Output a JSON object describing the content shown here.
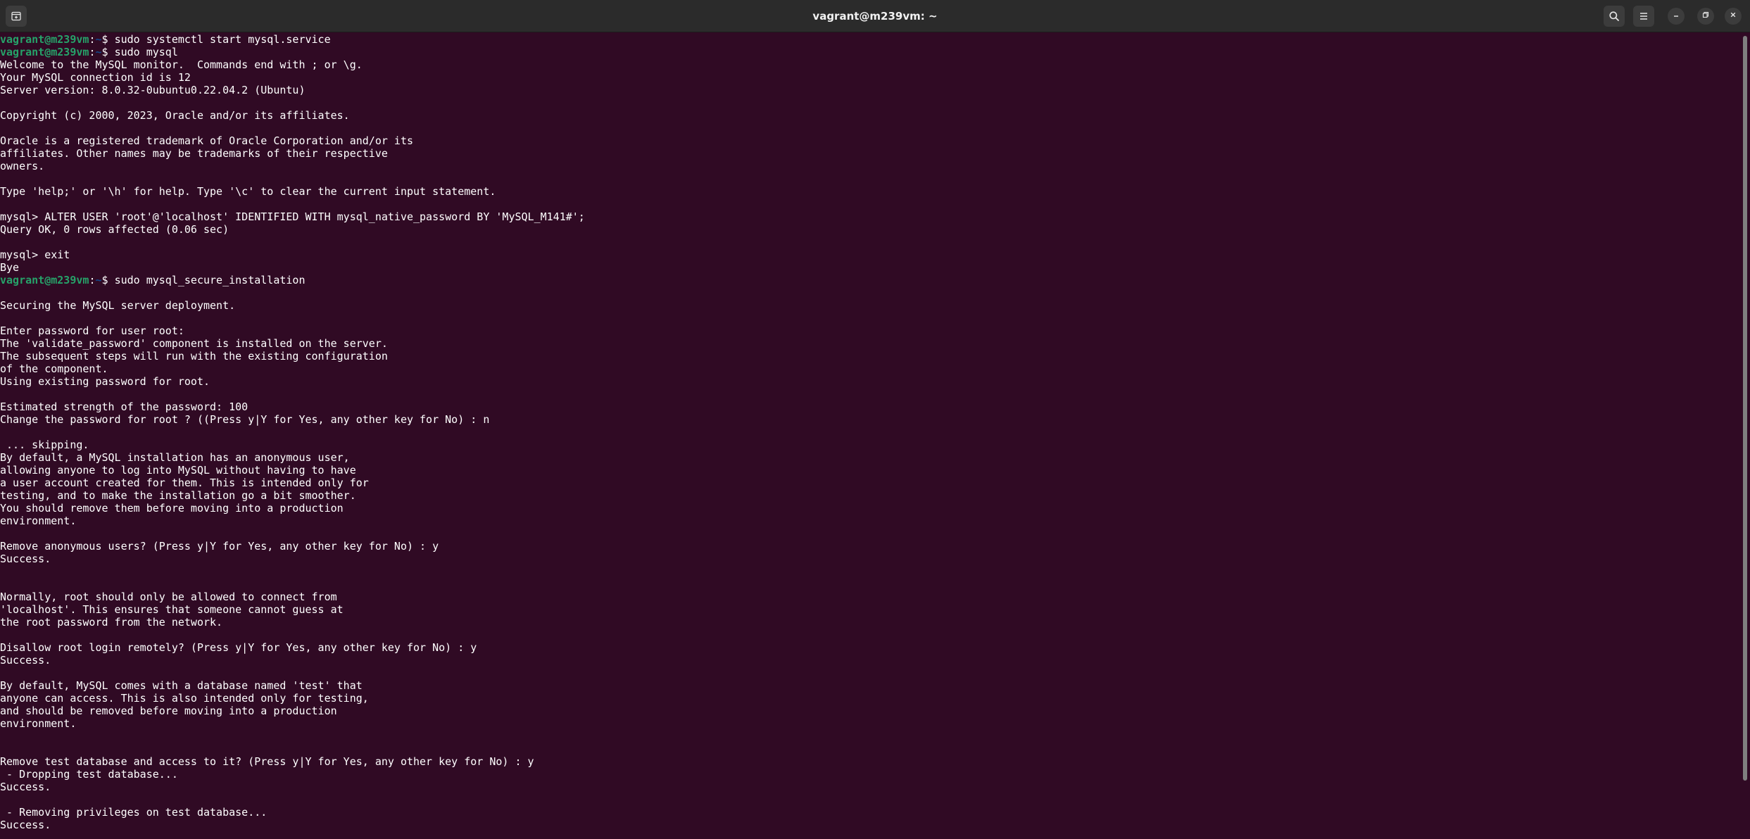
{
  "window": {
    "title": "vagrant@m239vm: ~"
  },
  "icons": {
    "new_tab": "new-tab-icon",
    "search": "search-icon",
    "menu": "hamburger-menu-icon",
    "minimize": "minimize-icon",
    "maximize": "maximize-icon",
    "close": "close-icon"
  },
  "colors": {
    "background": "#300a24",
    "titlebar": "#2b2b2b",
    "prompt_user": "#26a269",
    "prompt_path": "#12488b",
    "text": "#ffffff"
  },
  "prompt": {
    "user_host": "vagrant@m239vm",
    "separator": ":",
    "path": "~",
    "symbol": "$ "
  },
  "terminal": {
    "lines": [
      {
        "prompt": true,
        "text": "sudo systemctl start mysql.service"
      },
      {
        "prompt": true,
        "text": "sudo mysql"
      },
      {
        "text": "Welcome to the MySQL monitor.  Commands end with ; or \\g."
      },
      {
        "text": "Your MySQL connection id is 12"
      },
      {
        "text": "Server version: 8.0.32-0ubuntu0.22.04.2 (Ubuntu)"
      },
      {
        "text": ""
      },
      {
        "text": "Copyright (c) 2000, 2023, Oracle and/or its affiliates."
      },
      {
        "text": ""
      },
      {
        "text": "Oracle is a registered trademark of Oracle Corporation and/or its"
      },
      {
        "text": "affiliates. Other names may be trademarks of their respective"
      },
      {
        "text": "owners."
      },
      {
        "text": ""
      },
      {
        "text": "Type 'help;' or '\\h' for help. Type '\\c' to clear the current input statement."
      },
      {
        "text": ""
      },
      {
        "text": "mysql> ALTER USER 'root'@'localhost' IDENTIFIED WITH mysql_native_password BY 'MySQL_M141#';"
      },
      {
        "text": "Query OK, 0 rows affected (0.06 sec)"
      },
      {
        "text": ""
      },
      {
        "text": "mysql> exit"
      },
      {
        "text": "Bye"
      },
      {
        "prompt": true,
        "text": "sudo mysql_secure_installation"
      },
      {
        "text": ""
      },
      {
        "text": "Securing the MySQL server deployment."
      },
      {
        "text": ""
      },
      {
        "text": "Enter password for user root: "
      },
      {
        "text": "The 'validate_password' component is installed on the server."
      },
      {
        "text": "The subsequent steps will run with the existing configuration"
      },
      {
        "text": "of the component."
      },
      {
        "text": "Using existing password for root."
      },
      {
        "text": ""
      },
      {
        "text": "Estimated strength of the password: 100 "
      },
      {
        "text": "Change the password for root ? ((Press y|Y for Yes, any other key for No) : n"
      },
      {
        "text": ""
      },
      {
        "text": " ... skipping."
      },
      {
        "text": "By default, a MySQL installation has an anonymous user,"
      },
      {
        "text": "allowing anyone to log into MySQL without having to have"
      },
      {
        "text": "a user account created for them. This is intended only for"
      },
      {
        "text": "testing, and to make the installation go a bit smoother."
      },
      {
        "text": "You should remove them before moving into a production"
      },
      {
        "text": "environment."
      },
      {
        "text": ""
      },
      {
        "text": "Remove anonymous users? (Press y|Y for Yes, any other key for No) : y"
      },
      {
        "text": "Success."
      },
      {
        "text": ""
      },
      {
        "text": ""
      },
      {
        "text": "Normally, root should only be allowed to connect from"
      },
      {
        "text": "'localhost'. This ensures that someone cannot guess at"
      },
      {
        "text": "the root password from the network."
      },
      {
        "text": ""
      },
      {
        "text": "Disallow root login remotely? (Press y|Y for Yes, any other key for No) : y"
      },
      {
        "text": "Success."
      },
      {
        "text": ""
      },
      {
        "text": "By default, MySQL comes with a database named 'test' that"
      },
      {
        "text": "anyone can access. This is also intended only for testing,"
      },
      {
        "text": "and should be removed before moving into a production"
      },
      {
        "text": "environment."
      },
      {
        "text": ""
      },
      {
        "text": ""
      },
      {
        "text": "Remove test database and access to it? (Press y|Y for Yes, any other key for No) : y"
      },
      {
        "text": " - Dropping test database..."
      },
      {
        "text": "Success."
      },
      {
        "text": ""
      },
      {
        "text": " - Removing privileges on test database..."
      },
      {
        "text": "Success."
      }
    ]
  }
}
